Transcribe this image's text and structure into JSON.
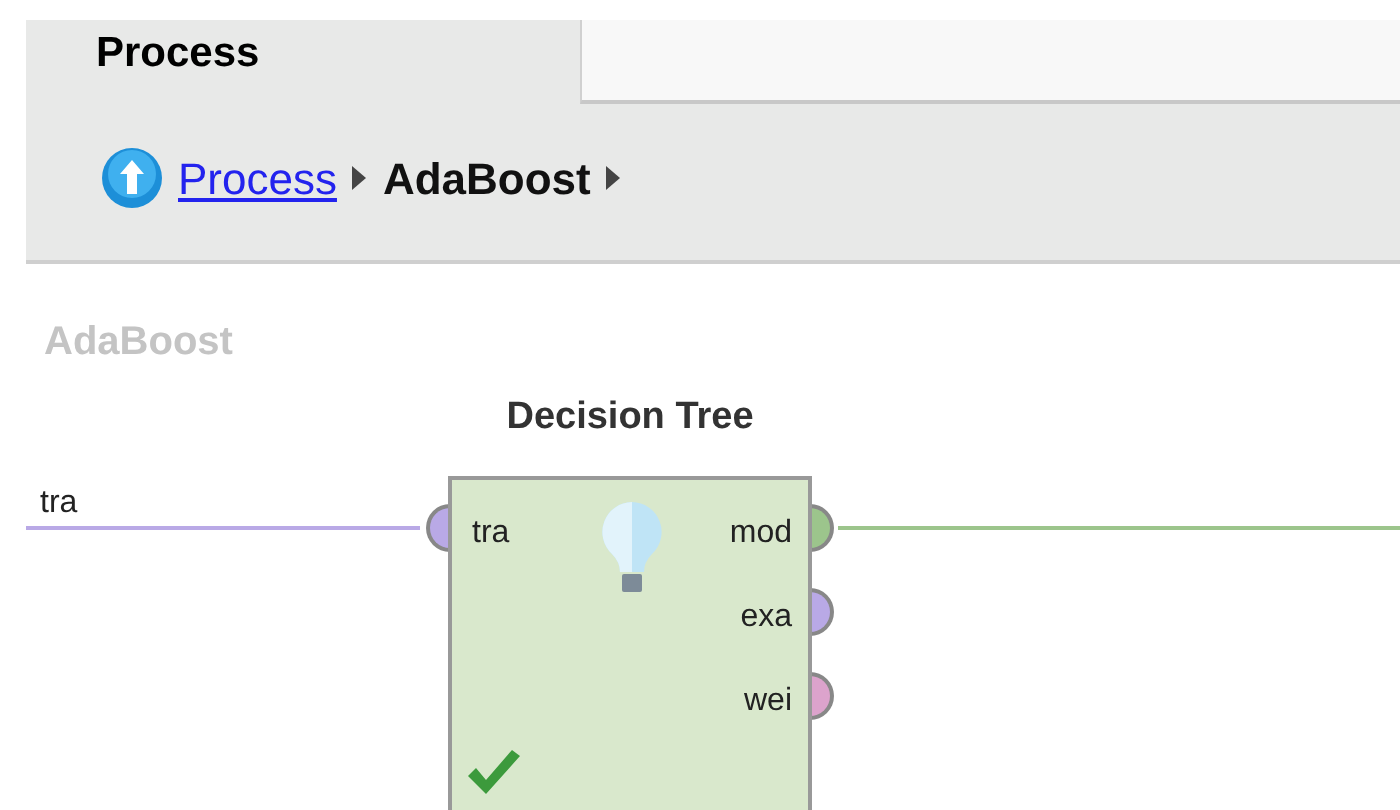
{
  "tabs": [
    {
      "label": "Process",
      "selected": true
    }
  ],
  "breadcrumb": {
    "link": "Process",
    "current": "AdaBoost"
  },
  "canvas": {
    "title": "AdaBoost",
    "source_port": {
      "label": "tra",
      "color": "#b9a9e6"
    },
    "operator": {
      "name": "Decision Tree",
      "inputs": [
        {
          "label": "tra",
          "color": "#b9a9e6"
        }
      ],
      "outputs": [
        {
          "label": "mod",
          "color": "#9cc58c",
          "connected": true
        },
        {
          "label": "exa",
          "color": "#b9a9e6",
          "connected": false
        },
        {
          "label": "wei",
          "color": "#dca3cc",
          "connected": false
        }
      ]
    }
  }
}
